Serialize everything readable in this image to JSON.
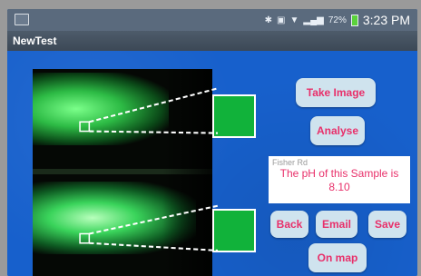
{
  "statusbar": {
    "time": "3:23 PM",
    "battery": "72%",
    "icons": [
      "notification-app-icon",
      "bluetooth-icon",
      "vibrate-icon",
      "wifi-icon",
      "signal-icon",
      "battery-icon"
    ]
  },
  "app": {
    "title": "NewTest"
  },
  "buttons": {
    "take_image": "Take Image",
    "analyse": "Analyse",
    "back": "Back",
    "email": "Email",
    "save": "Save",
    "on_map": "On map"
  },
  "result": {
    "location": "Fisher Rd",
    "text": "The pH of this Sample is",
    "value": "8.10"
  },
  "colors": {
    "background": "#1760cc",
    "button_text": "#e8306a",
    "button_bg": "#cfe3ee",
    "swatch": "#11b23a"
  }
}
